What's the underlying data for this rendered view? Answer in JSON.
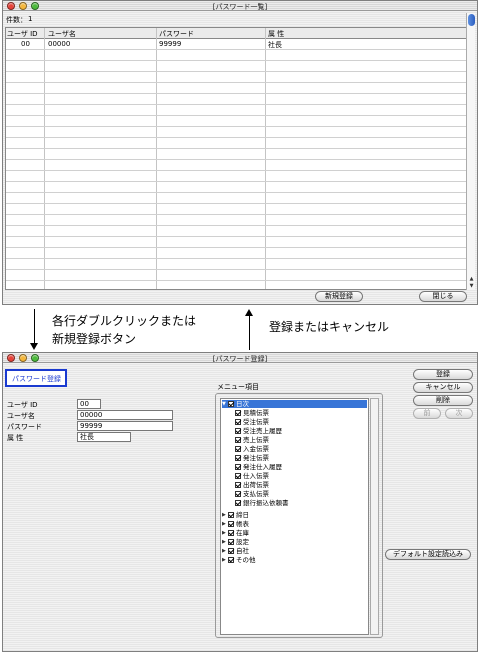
{
  "list_window": {
    "title": "[パスワード一覧]",
    "count_label": "件数：",
    "count_value": "1",
    "columns": [
      "ユーザ ID",
      "ユーザ名",
      "パスワード",
      "属 性"
    ],
    "rows": [
      [
        "00",
        "00000",
        "99999",
        "社長"
      ]
    ],
    "new_button": "新規登録",
    "close_button": "閉じる"
  },
  "annotations": {
    "left_line1": "各行ダブルクリックまたは",
    "left_line2": "新規登録ボタン",
    "right": "登録またはキャンセル"
  },
  "edit_window": {
    "title": "[パスワード登録]",
    "section_label": "パスワード登録",
    "fields": [
      {
        "label": "ユーザ ID",
        "value": "00"
      },
      {
        "label": "ユーザ名",
        "value": "00000"
      },
      {
        "label": "パスワード",
        "value": "99999"
      },
      {
        "label": "属 性",
        "value": "社長"
      }
    ],
    "menu_label": "メニュー項目",
    "buttons": {
      "register": "登録",
      "cancel": "キャンセル",
      "delete": "削除",
      "prev": "前",
      "next": "次",
      "default": "デフォルト設定読込み"
    },
    "tree": {
      "root": "日次",
      "children": [
        "見積伝票",
        "受注伝票",
        "受注売上履歴",
        "売上伝票",
        "入金伝票",
        "発注伝票",
        "発注仕入履歴",
        "仕入伝票",
        "出荷伝票",
        "支払伝票",
        "銀行振込依頼書"
      ],
      "groups": [
        "締日",
        "帳表",
        "在庫",
        "設定",
        "自社",
        "その他"
      ]
    }
  },
  "colors": {
    "close_light": "#e8443a",
    "min_light": "#f5b73b",
    "zoom_light": "#4cbb3b",
    "section_border": "#1a3ad0",
    "section_text": "#1a3ad0",
    "selection": "#3875d7"
  }
}
